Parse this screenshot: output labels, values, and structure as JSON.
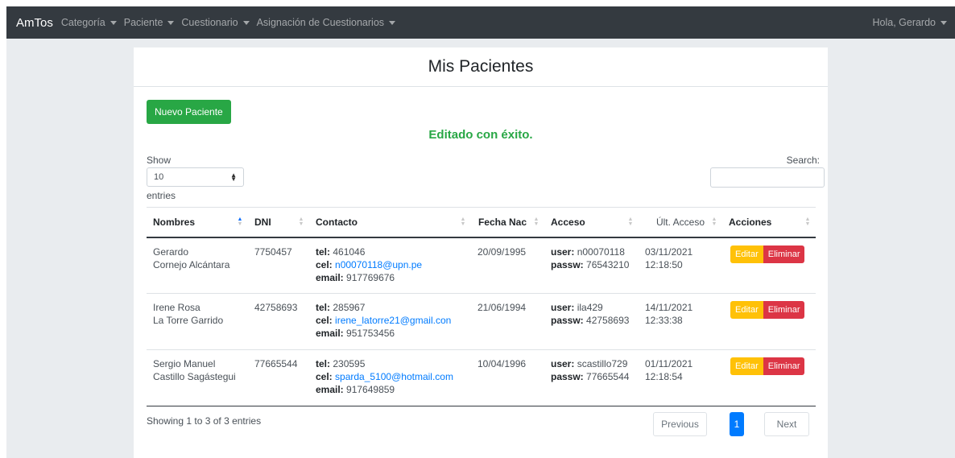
{
  "navbar": {
    "brand": "AmTos",
    "items": [
      "Categoría",
      "Paciente",
      "Cuestionario",
      "Asignación de Cuestionarios"
    ],
    "user": "Hola, Gerardo"
  },
  "card": {
    "title": "Mis Pacientes",
    "new_button": "Nuevo Paciente",
    "success": "Editado con éxito."
  },
  "controls": {
    "show_label": "Show",
    "length_value": "10",
    "entries_label": "entries",
    "search_label": "Search:"
  },
  "table": {
    "headers": [
      "Nombres",
      "DNI",
      "Contacto",
      "Fecha Nac",
      "Acceso",
      "Últ. Acceso",
      "Acciones"
    ],
    "tel_label": "tel:",
    "cel_label": "cel:",
    "email_label": "email:",
    "user_label": "user:",
    "passw_label": "passw:",
    "edit_label": "Editar",
    "delete_label": "Eliminar",
    "rows": [
      {
        "name1": "Gerardo",
        "name2": "Cornejo Alcántara",
        "dni": "7750457",
        "tel": "461046",
        "cel": "n00070118@upn.pe",
        "email": "917769676",
        "fecha": "20/09/1995",
        "user": "n00070118",
        "passw": "76543210",
        "ult1": "03/11/2021",
        "ult2": "12:18:50"
      },
      {
        "name1": "Irene Rosa",
        "name2": "La Torre Garrido",
        "dni": "42758693",
        "tel": "285967",
        "cel": "irene_latorre21@gmail.con",
        "email": "951753456",
        "fecha": "21/06/1994",
        "user": "ila429",
        "passw": "42758693",
        "ult1": "14/11/2021",
        "ult2": "12:33:38"
      },
      {
        "name1": "Sergio Manuel",
        "name2": "Castillo Sagástegui",
        "dni": "77665544",
        "tel": "230595",
        "cel": "sparda_5100@hotmail.com",
        "email": "917649859",
        "fecha": "10/04/1996",
        "user": "scastillo729",
        "passw": "77665544",
        "ult1": "01/11/2021",
        "ult2": "12:18:54"
      }
    ]
  },
  "footer": {
    "info": "Showing 1 to 3 of 3 entries",
    "previous": "Previous",
    "page": "1",
    "next": "Next"
  }
}
